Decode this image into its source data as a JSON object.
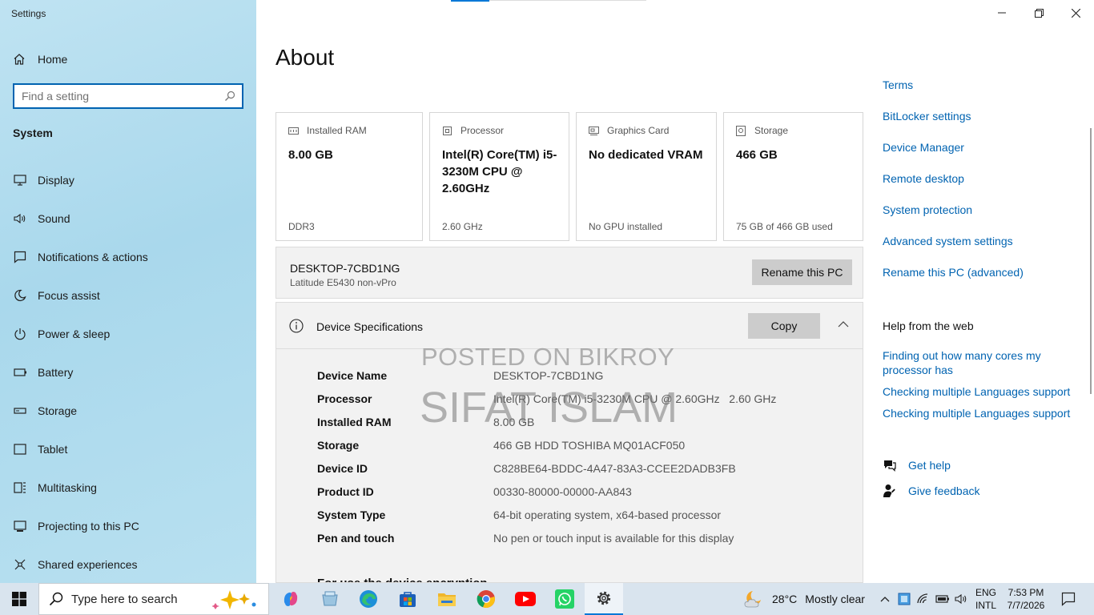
{
  "app": {
    "title": "Settings"
  },
  "sidebar": {
    "home_label": "Home",
    "search_placeholder": "Find a setting",
    "section_label": "System",
    "items": [
      {
        "label": "Display",
        "icon": "monitor-icon"
      },
      {
        "label": "Sound",
        "icon": "speaker-icon"
      },
      {
        "label": "Notifications & actions",
        "icon": "notification-icon"
      },
      {
        "label": "Focus assist",
        "icon": "moon-icon"
      },
      {
        "label": "Power & sleep",
        "icon": "power-icon"
      },
      {
        "label": "Battery",
        "icon": "battery-icon"
      },
      {
        "label": "Storage",
        "icon": "storage-icon"
      },
      {
        "label": "Tablet",
        "icon": "tablet-icon"
      },
      {
        "label": "Multitasking",
        "icon": "multitasking-icon"
      },
      {
        "label": "Projecting to this PC",
        "icon": "projecting-icon"
      },
      {
        "label": "Shared experiences",
        "icon": "shared-icon"
      }
    ]
  },
  "main": {
    "title": "About",
    "cards": [
      {
        "header": "Installed RAM",
        "value": "8.00 GB",
        "sub": "DDR3",
        "icon": "ram-icon"
      },
      {
        "header": "Processor",
        "value": "Intel(R) Core(TM) i5-3230M CPU @ 2.60GHz",
        "sub": "2.60 GHz",
        "icon": "processor-icon"
      },
      {
        "header": "Graphics Card",
        "value": "No dedicated VRAM",
        "sub": "No GPU installed",
        "icon": "graphics-card-icon"
      },
      {
        "header": "Storage",
        "value": "466 GB",
        "sub": "75 GB of 466 GB used",
        "icon": "storage-icon"
      }
    ],
    "pc_name": "DESKTOP-7CBD1NG",
    "pc_model": "Latitude E5430 non-vPro",
    "rename_button": "Rename this PC",
    "specs": {
      "title": "Device Specifications",
      "copy_button": "Copy",
      "rows": [
        {
          "key": "Device Name",
          "value": "DESKTOP-7CBD1NG"
        },
        {
          "key": "Processor",
          "value": "Intel(R) Core(TM) i5-3230M CPU @ 2.60GHz   2.60 GHz"
        },
        {
          "key": "Installed RAM",
          "value": "8.00 GB"
        },
        {
          "key": "Storage",
          "value": "466 GB HDD TOSHIBA MQ01ACF050"
        },
        {
          "key": "Device ID",
          "value": "C828BE64-BDDC-4A47-83A3-CCEE2DADB3FB"
        },
        {
          "key": "Product ID",
          "value": "00330-80000-00000-AA843"
        },
        {
          "key": "System Type",
          "value": "64-bit operating system, x64-based processor"
        },
        {
          "key": "Pen and touch",
          "value": "No pen or touch input is available for this display"
        }
      ],
      "cut_off_heading": "For use the device encryption"
    },
    "watermark": {
      "line1": "POSTED ON BIKROY",
      "line2": "SIFAT ISLAM"
    }
  },
  "right": {
    "links": [
      "Terms",
      "BitLocker settings",
      "Device Manager",
      "Remote desktop",
      "System protection",
      "Advanced system settings",
      "Rename this PC (advanced)"
    ],
    "help_heading": "Help from the web",
    "web_links": [
      "Finding out how many cores my processor has",
      "Checking multiple Languages support",
      "Checking multiple Languages support"
    ],
    "help_items": [
      {
        "label": "Get help",
        "icon": "get-help-icon"
      },
      {
        "label": "Give feedback",
        "icon": "feedback-icon"
      }
    ]
  },
  "taskbar": {
    "search_placeholder": "Type here to search",
    "apps": [
      "copilot-icon",
      "file-explorer-alt-icon",
      "edge-icon",
      "store-icon",
      "file-explorer-icon",
      "chrome-icon",
      "youtube-icon",
      "whatsapp-icon",
      "settings-icon"
    ],
    "weather": {
      "temp": "28°C",
      "condition": "Mostly clear"
    },
    "lang": {
      "line1": "ENG",
      "line2": "INTL"
    },
    "clock": {
      "time": "7:53 PM",
      "date": "7/7/2026"
    }
  },
  "colors": {
    "accent": "#0078d7",
    "link": "#0063b1",
    "sidebar": "#b3dcee",
    "taskbar": "#d9e4ee"
  }
}
